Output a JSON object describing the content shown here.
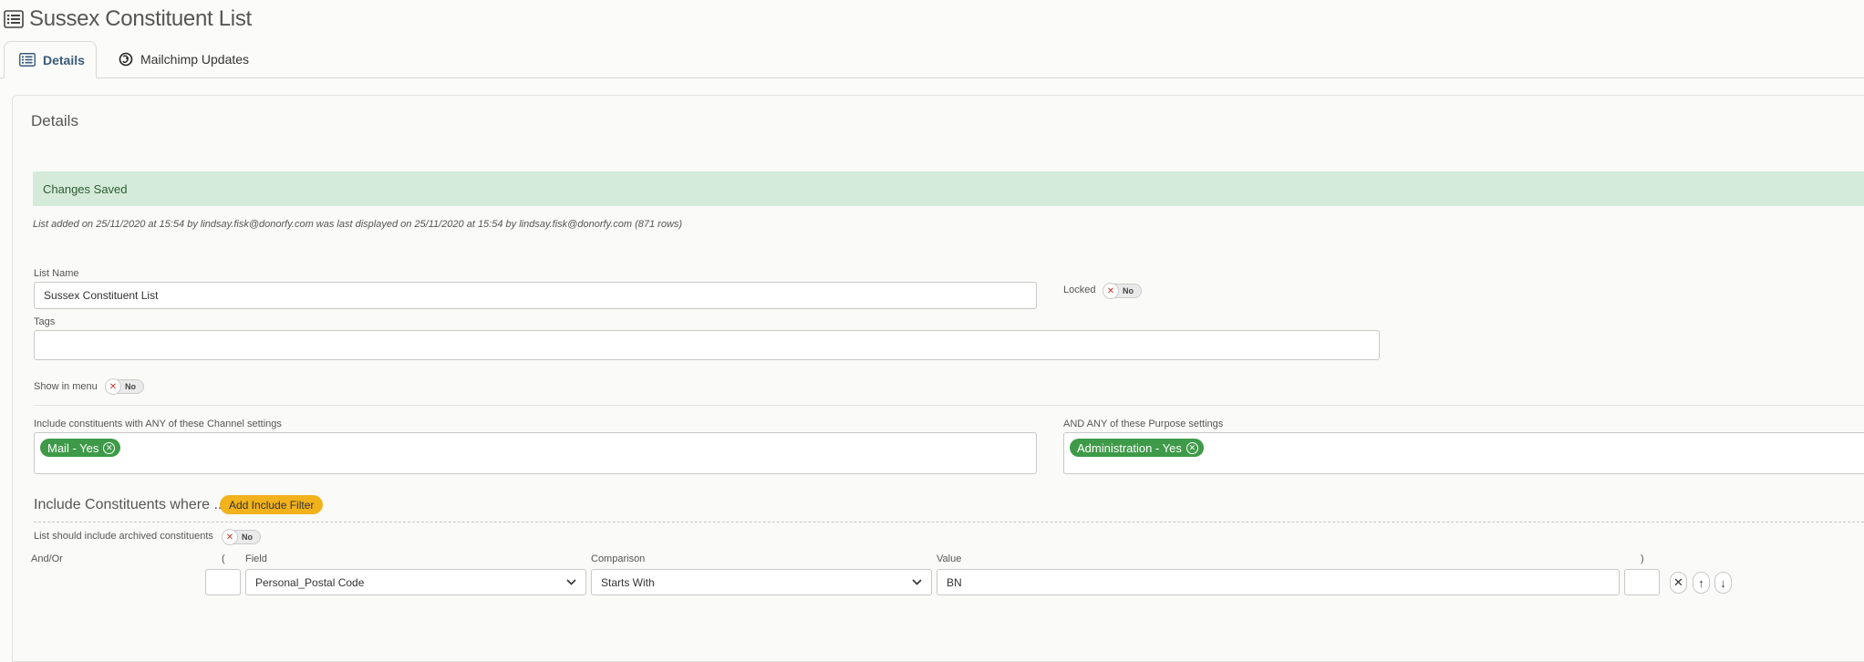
{
  "page": {
    "title": "Sussex Constituent List"
  },
  "tabs": [
    {
      "label": "Details",
      "icon": "list-icon",
      "active": true
    },
    {
      "label": "Mailchimp Updates",
      "icon": "mailchimp-icon",
      "active": false
    }
  ],
  "details": {
    "section_title": "Details",
    "alert": "Changes Saved",
    "meta": "List added on 25/11/2020 at 15:54 by lindsay.fisk@donorfy.com was last displayed on 25/11/2020 at 15:54 by lindsay.fisk@donorfy.com (871 rows)",
    "list_name_label": "List Name",
    "list_name_value": "Sussex Constituent List",
    "locked_label": "Locked",
    "locked_value": "No",
    "tags_label": "Tags",
    "tags_value": "",
    "show_in_menu_label": "Show in menu",
    "show_in_menu_value": "No",
    "channel_label": "Include constituents with ANY of these Channel settings",
    "channel_chips": [
      "Mail - Yes"
    ],
    "purpose_label": "AND ANY of these Purpose settings",
    "purpose_chips": [
      "Administration - Yes"
    ]
  },
  "filters": {
    "heading": "Include Constituents where ...",
    "add_button": "Add Include Filter",
    "archived_label": "List should include archived constituents",
    "archived_value": "No",
    "columns": {
      "and_or": "And/Or",
      "open_paren": "(",
      "field": "Field",
      "comparison": "Comparison",
      "value": "Value",
      "close_paren": ")"
    },
    "rows": [
      {
        "open_paren": "",
        "field": "Personal_Postal Code",
        "comparison": "Starts With",
        "value": "BN",
        "close_paren": ""
      }
    ],
    "row_actions": {
      "delete": "✕",
      "up": "↑",
      "down": "↓"
    }
  },
  "colors": {
    "alert_bg": "#d5ebd9",
    "chip_green": "#3e9a48",
    "add_button": "#f2b21b",
    "active_tab_text": "#3a5a7a"
  }
}
